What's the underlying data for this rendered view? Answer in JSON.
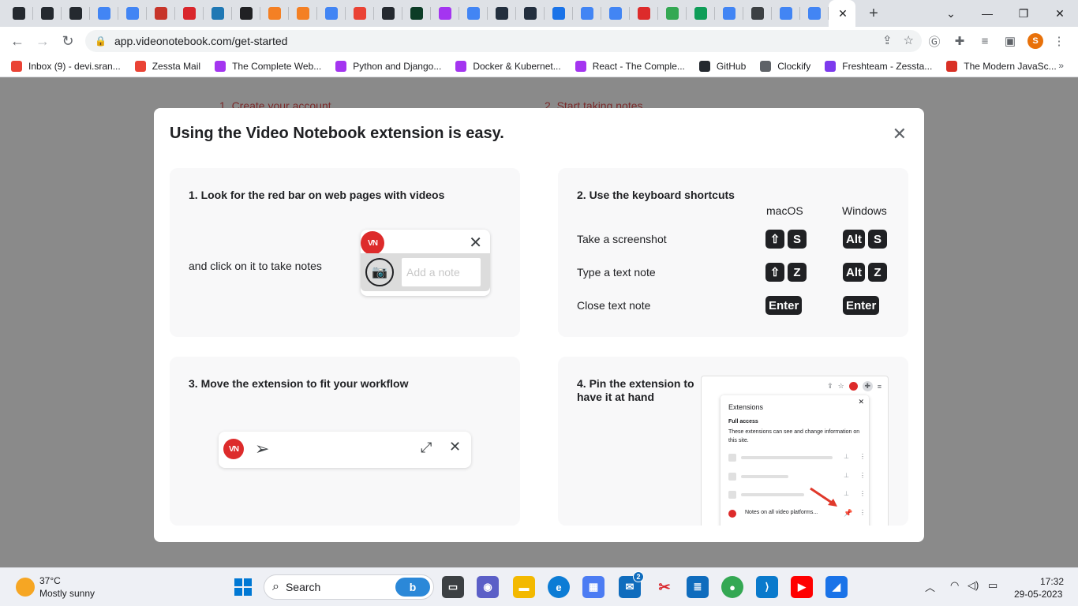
{
  "browser": {
    "tabs": [
      {
        "icon": "github-icon",
        "color": "#24292f"
      },
      {
        "icon": "github-icon",
        "color": "#24292f"
      },
      {
        "icon": "github-icon",
        "color": "#24292f"
      },
      {
        "icon": "google-icon",
        "color": "#4285f4"
      },
      {
        "icon": "google-docs-icon",
        "color": "#4285f4"
      },
      {
        "icon": "aws-icon",
        "color": "#c7352a"
      },
      {
        "icon": "red-app-icon",
        "color": "#d9262c"
      },
      {
        "icon": "react-icon",
        "color": "#1f78b4"
      },
      {
        "icon": "r-icon",
        "color": "#202124"
      },
      {
        "icon": "stackoverflow-icon",
        "color": "#f48024"
      },
      {
        "icon": "stackoverflow-icon",
        "color": "#f48024"
      },
      {
        "icon": "google-icon",
        "color": "#4285f4"
      },
      {
        "icon": "gmail-icon",
        "color": "#ea4335"
      },
      {
        "icon": "github-icon",
        "color": "#24292f"
      },
      {
        "icon": "django-icon",
        "color": "#0c3c26"
      },
      {
        "icon": "udemy-icon",
        "color": "#a435f0"
      },
      {
        "icon": "google-icon",
        "color": "#4285f4"
      },
      {
        "icon": "amazon-icon",
        "color": "#232f3e"
      },
      {
        "icon": "amazon-icon",
        "color": "#232f3e"
      },
      {
        "icon": "spiral-icon",
        "color": "#1a73e8"
      },
      {
        "icon": "google-icon",
        "color": "#4285f4"
      },
      {
        "icon": "google-icon",
        "color": "#4285f4"
      },
      {
        "icon": "videonotebook-icon",
        "color": "#dd2b2b"
      },
      {
        "icon": "drive-icon",
        "color": "#34a853"
      },
      {
        "icon": "gg-icon",
        "color": "#0f9d58"
      },
      {
        "icon": "google-icon",
        "color": "#4285f4"
      },
      {
        "icon": "t-icon",
        "color": "#3c4043"
      },
      {
        "icon": "google-icon",
        "color": "#4285f4"
      },
      {
        "icon": "google-icon",
        "color": "#4285f4"
      }
    ],
    "url": "app.videonotebook.com/get-started",
    "profile_initial": "S",
    "bookmarks": [
      {
        "label": "Inbox (9) - devi.sran...",
        "icon": "gmail-icon",
        "color": "#ea4335"
      },
      {
        "label": "Zessta Mail",
        "icon": "gmail-icon",
        "color": "#ea4335"
      },
      {
        "label": "The Complete Web...",
        "icon": "udemy-icon",
        "color": "#a435f0"
      },
      {
        "label": "Python and Django...",
        "icon": "udemy-icon",
        "color": "#a435f0"
      },
      {
        "label": "Docker & Kubernet...",
        "icon": "udemy-icon",
        "color": "#a435f0"
      },
      {
        "label": "React - The Comple...",
        "icon": "udemy-icon",
        "color": "#a435f0"
      },
      {
        "label": "GitHub",
        "icon": "github-icon",
        "color": "#24292f"
      },
      {
        "label": "Clockify",
        "icon": "clockify-icon",
        "color": "#5f6368"
      },
      {
        "label": "Freshteam - Zessta...",
        "icon": "freshteam-icon",
        "color": "#7c3aed"
      },
      {
        "label": "The Modern JavaSc...",
        "icon": "js-icon",
        "color": "#d93025"
      }
    ]
  },
  "page": {
    "bg_step1": "1. Create your account",
    "bg_step2": "2. Start taking notes",
    "modal": {
      "title": "Using the Video Notebook extension is easy.",
      "card1": {
        "title": "1. Look for the red bar on web pages with videos",
        "text": "and click on it to take notes",
        "logo": "VN",
        "placeholder": "Add a note"
      },
      "card2": {
        "title": "2. Use the keyboard shortcuts",
        "col_mac": "macOS",
        "col_win": "Windows",
        "rows": [
          {
            "label": "Take a screenshot",
            "mac_mod": "⇧",
            "mac_key": "S",
            "win_mod": "Alt",
            "win_key": "S"
          },
          {
            "label": "Type a text note",
            "mac_mod": "⇧",
            "mac_key": "Z",
            "win_mod": "Alt",
            "win_key": "Z"
          },
          {
            "label": "Close text note",
            "mac_key": "Enter",
            "win_key": "Enter"
          }
        ]
      },
      "card3": {
        "title": "3. Move the extension to fit your workflow",
        "logo": "VN"
      },
      "card4": {
        "title": "4. Pin the extension to have it at hand",
        "panel_title": "Extensions",
        "full_access": "Full access",
        "full_access_desc": "These extensions can see and change information on this site.",
        "ext_name": "Notes on all video platforms..."
      }
    }
  },
  "taskbar": {
    "weather_temp": "37°C",
    "weather_desc": "Mostly sunny",
    "search": "Search",
    "time": "17:32",
    "date": "29-05-2023",
    "mail_badge": "2"
  }
}
